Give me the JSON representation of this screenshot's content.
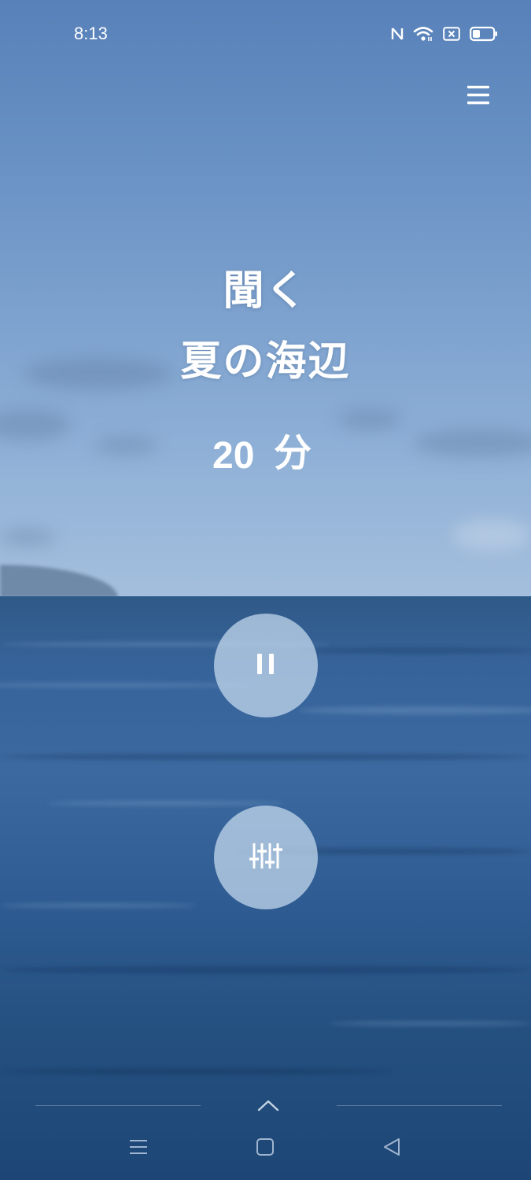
{
  "status_bar": {
    "time": "8:13",
    "icons": [
      "nfc-icon",
      "wifi-icon",
      "sim-off-icon",
      "battery-icon"
    ],
    "battery_level": 0.35
  },
  "header": {
    "menu_icon": "hamburger-menu-icon"
  },
  "player": {
    "action_label": "聞く",
    "sound_title": "夏の海辺",
    "duration_value": "20",
    "duration_unit": "分",
    "pause_icon": "pause-icon",
    "mixer_icon": "equalizer-sliders-icon"
  },
  "navigation": {
    "swipe_icon": "chevron-up-icon",
    "buttons": [
      "recents-icon",
      "home-icon",
      "back-icon"
    ]
  },
  "colors": {
    "sky_top": "#5781b9",
    "sky_horizon": "#a4bfdd",
    "sea": "#2d5a90",
    "button_fill": "#c8dcf0",
    "text": "#ffffff"
  }
}
